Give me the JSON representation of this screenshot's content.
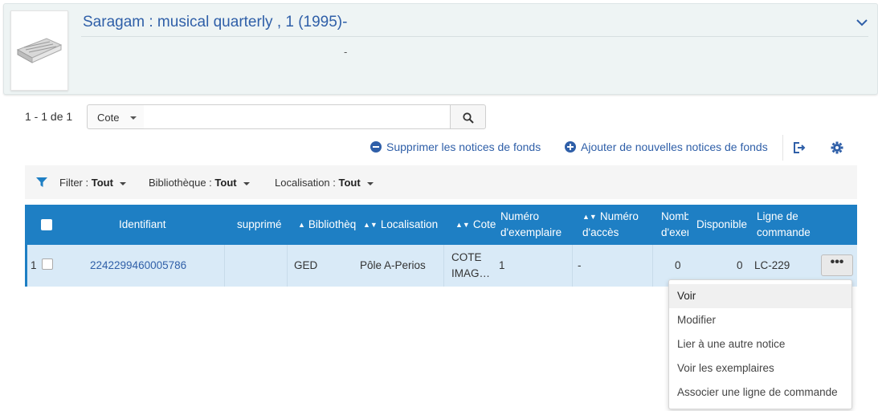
{
  "record": {
    "title": "Saragam : musical quarterly , 1 (1995)-",
    "subtitle": "-",
    "thumbnail_icon": "serial-book-icon"
  },
  "results": {
    "count_label": "1 - 1 de 1"
  },
  "search": {
    "field_selected": "Cote",
    "query": "",
    "button_icon": "search-icon"
  },
  "actions": {
    "delete_label": "Supprimer les notices de fonds",
    "add_label": "Ajouter de nouvelles notices de fonds",
    "export_icon": "export-icon",
    "settings_icon": "gear-icon"
  },
  "filters": {
    "filter_label": "Filter :",
    "filter_value": "Tout",
    "library_label": "Bibliothèque :",
    "library_value": "Tout",
    "location_label": "Localisation :",
    "location_value": "Tout"
  },
  "table": {
    "headers": {
      "identifier": "Identifiant",
      "deleted": "supprimé",
      "library": "Bibliothèque",
      "location": "Localisation",
      "call_number": "Cote",
      "copy_number": "Numéro d'exemplaire",
      "accession_number": "Numéro d'accès",
      "num_items": "Nombre d'exemplaires",
      "available": "Disponible",
      "order_line": "Ligne de commande"
    },
    "rows": [
      {
        "index": "1",
        "identifier": "2242299460005786",
        "deleted": "",
        "library": "GED",
        "location": "Pôle A-Perios",
        "call_number": "COTE IMAG…",
        "copy_number": "1",
        "accession_number": "-",
        "num_items": "0",
        "available": "0",
        "order_line": "LC-229",
        "more_label": "•••"
      }
    ]
  },
  "row_menu": {
    "items": [
      "Voir",
      "Modifier",
      "Lier à une autre notice",
      "Voir les exemplaires",
      "Associer une ligne de commande"
    ]
  },
  "colors": {
    "accent": "#2f5fa8",
    "header_bg": "#1e7fc4",
    "row_selected_bg": "#d9eaf7"
  }
}
